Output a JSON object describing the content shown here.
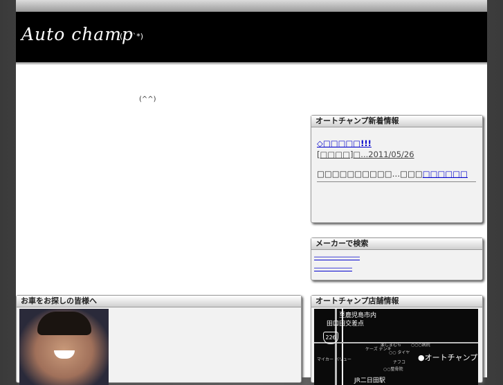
{
  "header": {
    "logo": "Auto champ",
    "face": "(´ ˘`*)"
  },
  "main": {
    "smile": "(^^)"
  },
  "news": {
    "title": "オートチャンプ新着情報",
    "link": "◇□□□□□!!!",
    "date": "[□□□□]□...2011/05/26",
    "text": "□□□□□□□□□□…□□□",
    "more": "□□□□□□"
  },
  "maker": {
    "title": "メーカーで検索",
    "items": [
      "――――――",
      "―――――"
    ]
  },
  "customer": {
    "title": "お車をお探しの皆様へ"
  },
  "shop": {
    "title": "オートチャンプ店舗情報",
    "map": {
      "city": "至鹿児島市内",
      "crossing": "田口田交差点",
      "route": "226",
      "shop": "●オートチャンプ",
      "station": "JR二日田駅",
      "s1": "ケーズ\nデンキ",
      "s2": "楽しまむら",
      "s3": "○○○病院",
      "s4": "○○\nタイヤ",
      "s5": "ナフコ",
      "s6": "マイカー\nバリュー",
      "s7": "○○整骨院"
    }
  }
}
